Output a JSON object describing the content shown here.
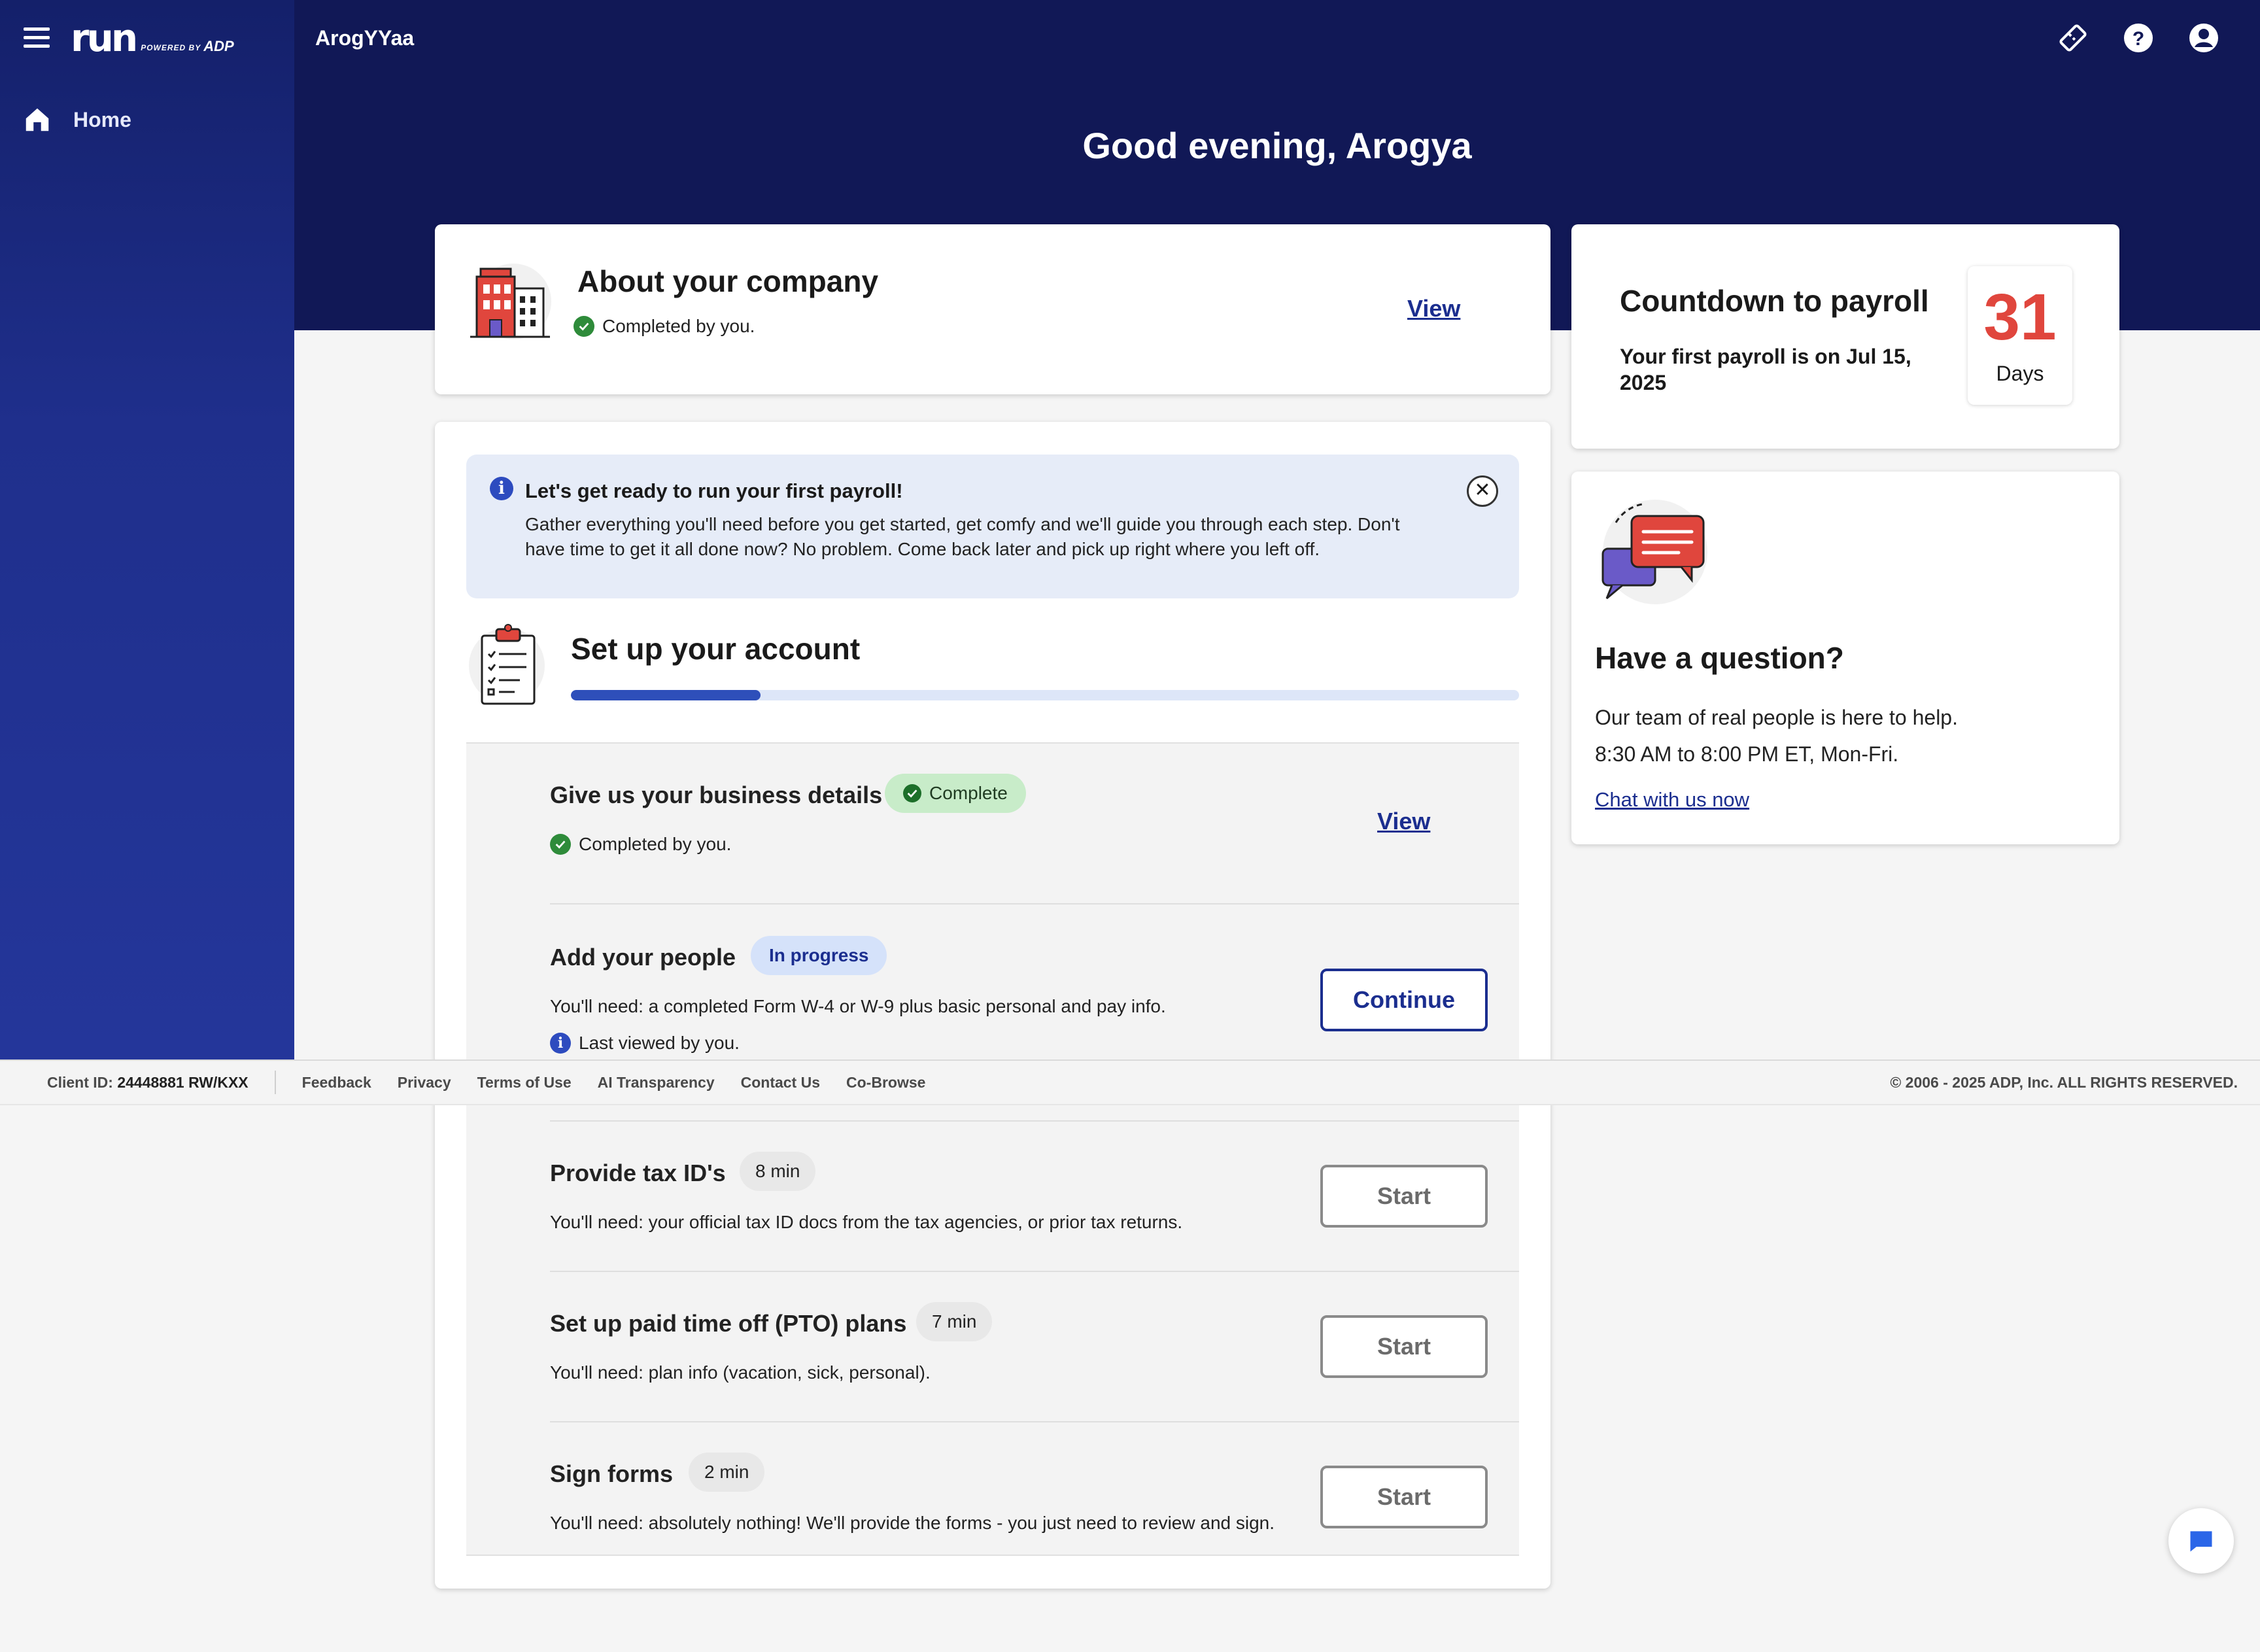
{
  "app": {
    "logo_text": "run",
    "logo_powered": "POWERED BY",
    "logo_brand": "ADP",
    "company_name": "ArogYYaa"
  },
  "sidebar": {
    "items": [
      {
        "label": "Home",
        "icon": "home-icon"
      }
    ]
  },
  "header": {
    "greeting": "Good evening, Arogya",
    "icons": [
      "ticket-icon",
      "help-icon",
      "account-icon"
    ]
  },
  "about_card": {
    "title": "About your company",
    "status": "Completed by you.",
    "link": "View"
  },
  "countdown": {
    "title": "Countdown to payroll",
    "subtitle": "Your first payroll is on Jul 15, 2025",
    "days_value": "31",
    "days_label": "Days"
  },
  "question_card": {
    "title": "Have a question?",
    "line1": "Our team of real people is here to help.",
    "line2": "8:30 AM to 8:00 PM ET, Mon-Fri.",
    "chat_link": "Chat with us now"
  },
  "banner": {
    "title": "Let's get ready to run your first payroll!",
    "text": "Gather everything you'll need before you get started, get comfy and we'll guide you through each step. Don't have time to get it all done now? No problem. Come back later and pick up right where you left off.",
    "close": "✕"
  },
  "setup": {
    "title": "Set up your account",
    "progress_fraction": 0.2,
    "tasks": [
      {
        "name": "Give us your business details",
        "badge": "Complete",
        "status": "Completed by you.",
        "action": "View"
      },
      {
        "name": "Add your people",
        "badge": "In progress",
        "need": "You'll need: a completed Form W-4 or W-9 plus basic personal and pay info.",
        "status": "Last viewed by you.",
        "action": "Continue"
      },
      {
        "name": "Provide tax ID's",
        "badge": "8 min",
        "need": "You'll need: your official tax ID docs from the tax agencies, or prior tax returns.",
        "action": "Start"
      },
      {
        "name": "Set up paid time off (PTO) plans",
        "badge": "7 min",
        "need": "You'll need: plan info (vacation, sick, personal).",
        "action": "Start"
      },
      {
        "name": "Sign forms",
        "badge": "2 min",
        "need": "You'll need: absolutely nothing! We'll provide the forms - you just need to review and sign.",
        "action": "Start"
      }
    ]
  },
  "footer": {
    "client_label": "Client ID:",
    "client_id": "24448881 RW/KXX",
    "links": [
      "Feedback",
      "Privacy",
      "Terms of Use",
      "AI Transparency",
      "Contact Us",
      "Co-Browse"
    ],
    "copyright": "© 2006 - 2025 ADP, Inc. ALL RIGHTS RESERVED."
  },
  "colors": {
    "navy": "#111856",
    "brand_blue": "#1b2e8f",
    "accent_red": "#e0463d",
    "success_green": "#2e8b3a"
  }
}
